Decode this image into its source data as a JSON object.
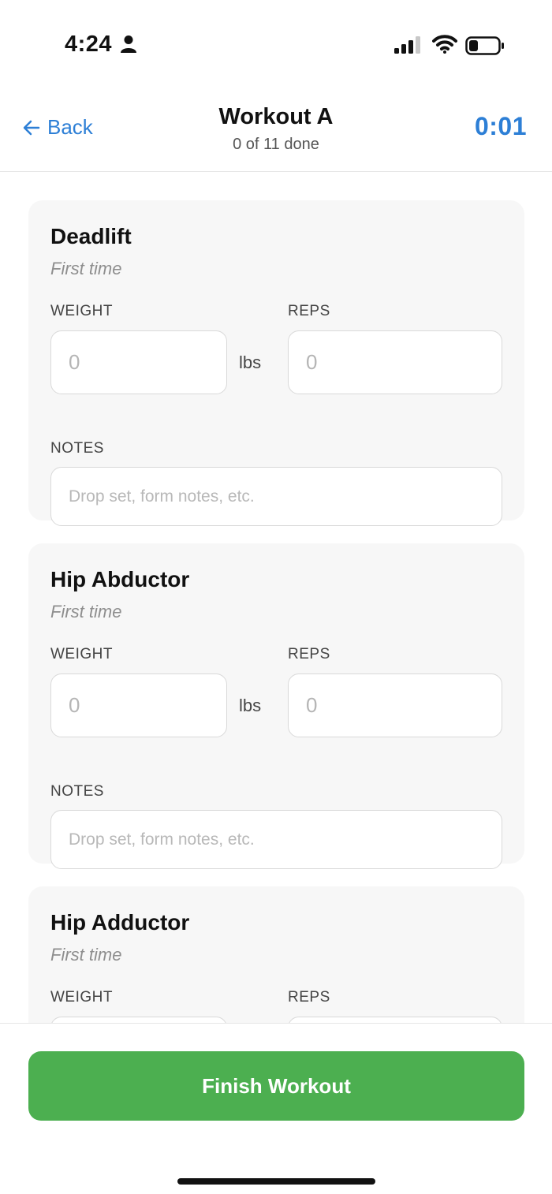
{
  "status_bar": {
    "time": "4:24",
    "icons": [
      "person-icon",
      "signal-icon",
      "wifi-icon",
      "battery-icon"
    ]
  },
  "nav": {
    "back_label": "Back",
    "title": "Workout A",
    "progress": "0 of 11 done",
    "timer": "0:01"
  },
  "colors": {
    "accent": "#2d7fd6",
    "finish_button": "#4caf50",
    "card_background": "#f7f7f7"
  },
  "exercises": [
    {
      "name": "Deadlift",
      "history": "First time",
      "weight_label": "WEIGHT",
      "weight_placeholder": "0",
      "unit": "lbs",
      "reps_label": "REPS",
      "reps_placeholder": "0",
      "notes_label": "NOTES",
      "notes_placeholder": "Drop set, form notes, etc."
    },
    {
      "name": "Hip Abductor",
      "history": "First time",
      "weight_label": "WEIGHT",
      "weight_placeholder": "0",
      "unit": "lbs",
      "reps_label": "REPS",
      "reps_placeholder": "0",
      "notes_label": "NOTES",
      "notes_placeholder": "Drop set, form notes, etc."
    },
    {
      "name": "Hip Adductor",
      "history": "First time",
      "weight_label": "WEIGHT",
      "reps_label": "REPS"
    }
  ],
  "footer": {
    "finish_label": "Finish Workout"
  }
}
